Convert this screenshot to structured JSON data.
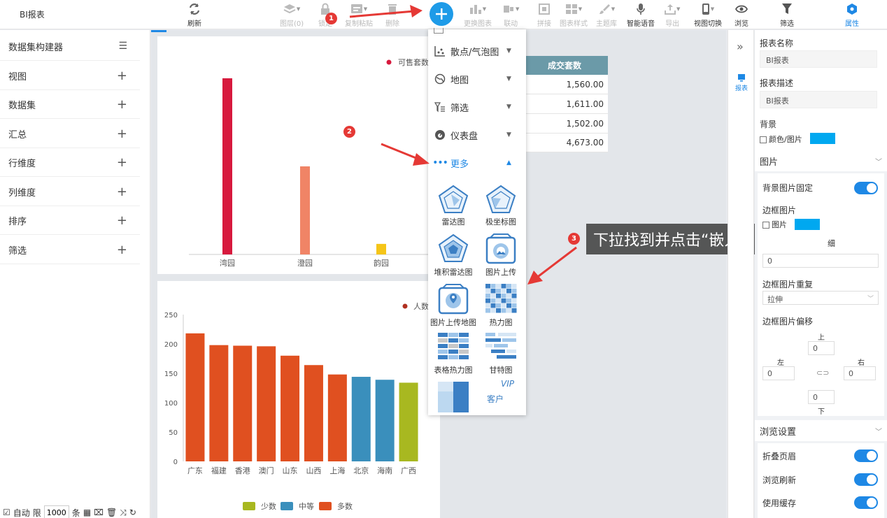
{
  "app_title": "BI报表",
  "toolbar": {
    "refresh": "刷新",
    "layers": "图层(0)",
    "lock": "锁定",
    "copy": "复制粘贴",
    "delete": "删除",
    "replace_chart": "更换图表",
    "link": "联动",
    "join": "拼接",
    "chart_style": "图表样式",
    "theme": "主题库",
    "voice": "智能语音",
    "export": "导出",
    "view_switch": "视图切换",
    "browse": "浏览",
    "filter_tab": "筛选",
    "props_tab": "属性"
  },
  "left_panel": {
    "title": "数据集构建器",
    "items": [
      "视图",
      "数据集",
      "汇总",
      "行维度",
      "列维度",
      "排序",
      "筛选"
    ],
    "footer": {
      "auto": "自动",
      "limit_prefix": "限",
      "limit_value": "1000",
      "limit_suffix": "条"
    }
  },
  "chart_top": {
    "legend": "可售套数",
    "chart_data": {
      "type": "bar",
      "categories": [
        "湾园",
        "澄园",
        "韵园"
      ],
      "series": [
        {
          "name": "可售套数",
          "values": [
            100,
            50,
            6
          ]
        }
      ],
      "colors": [
        "#d7193d",
        "#f08466",
        "#f5c518"
      ]
    }
  },
  "chart_bottom": {
    "legend_top": "人数",
    "legend_bottom": [
      "少数",
      "中等",
      "多数"
    ],
    "legend_colors": [
      "#a8b820",
      "#3a8fbc",
      "#e05020"
    ],
    "chart_data": {
      "type": "bar",
      "categories": [
        "广东",
        "福建",
        "香港",
        "澳门",
        "山东",
        "山西",
        "上海",
        "北京",
        "海南",
        "广西"
      ],
      "values": [
        218,
        198,
        197,
        196,
        180,
        164,
        148,
        144,
        139,
        134
      ],
      "groups": [
        "多数",
        "多数",
        "多数",
        "多数",
        "多数",
        "多数",
        "多数",
        "中等",
        "中等",
        "少数"
      ],
      "ylim": [
        0,
        250
      ],
      "yticks": [
        0,
        50,
        100,
        150,
        200,
        250
      ]
    }
  },
  "table": {
    "header": "成交套数",
    "rows": [
      "1,560.00",
      "1,611.00",
      "1,502.00",
      "4,673.00"
    ]
  },
  "dropdown": {
    "items": [
      {
        "label": "散点/气泡图",
        "icon": "scatter-icon"
      },
      {
        "label": "地图",
        "icon": "globe-icon"
      },
      {
        "label": "筛选",
        "icon": "filter-icon"
      },
      {
        "label": "仪表盘",
        "icon": "gauge-icon"
      }
    ],
    "more": "更多",
    "grid": [
      "雷达图",
      "极坐标图",
      "堆积雷达图",
      "图片上传",
      "图片上传地图",
      "热力图",
      "表格热力图",
      "甘特图"
    ],
    "vip_text": "VIP",
    "vip_sub": "客户"
  },
  "annotations": {
    "step1": "1",
    "step2": "2",
    "step3": "3",
    "callout": "下拉找到并点击“嵌入网页”"
  },
  "collapse": {
    "tab": "报表"
  },
  "right_panel": {
    "name_label": "报表名称",
    "name_value": "BI报表",
    "desc_label": "报表描述",
    "desc_value": "BI报表",
    "bg_label": "背景",
    "bg_option": "颜色/图片",
    "image_section": "图片",
    "bg_fixed": "背景图片固定",
    "border_img": "边框图片",
    "border_img_option": "图片",
    "border_suffix": "细",
    "border_width_value": "0",
    "border_repeat": "边框图片重复",
    "border_repeat_value": "拉伸",
    "border_offset": "边框图片偏移",
    "top": "上",
    "bottom": "下",
    "left": "左",
    "right": "右",
    "top_v": "0",
    "bottom_v": "0",
    "left_v": "0",
    "right_v": "0",
    "browse_section": "浏览设置",
    "fold_header": "折叠页眉",
    "browse_refresh": "浏览刷新",
    "use_cache": "使用缓存"
  },
  "colors": {
    "accent": "#1e88e5",
    "swatch": "#00a8f0",
    "table_header": "#6b9aa8"
  }
}
